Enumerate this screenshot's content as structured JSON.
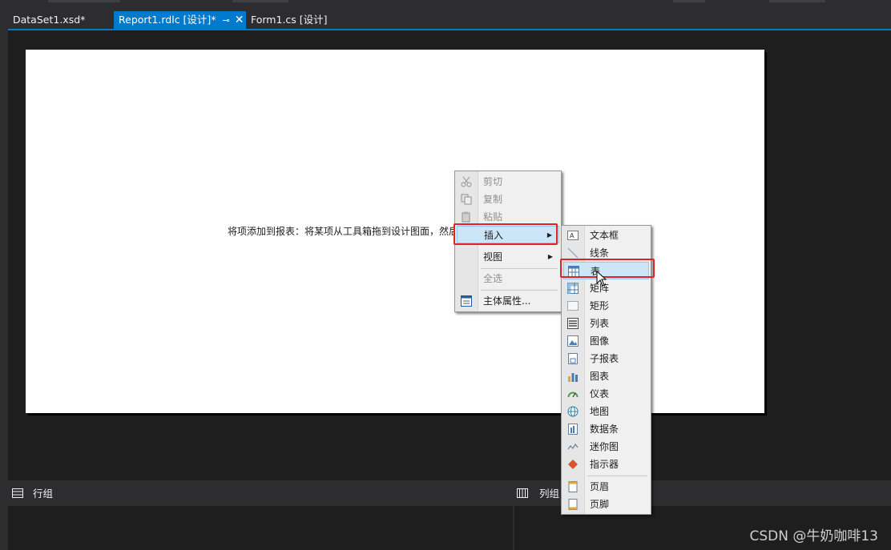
{
  "tabs": [
    {
      "label": "DataSet1.xsd*",
      "active": false
    },
    {
      "label": "Report1.rdlc [设计]*",
      "active": true,
      "pin": "⊸",
      "close": "✕"
    },
    {
      "label": "Form1.cs [设计]",
      "active": false
    }
  ],
  "design_surface": {
    "hint_text": "将项添加到报表：将某项从工具箱拖到设计图面，然后"
  },
  "groups": {
    "row_group_label": "行组",
    "column_group_label": "列组"
  },
  "context_menu": {
    "items": [
      {
        "label": "剪切",
        "icon": "scissors-icon",
        "disabled": true
      },
      {
        "label": "复制",
        "icon": "copy-icon",
        "disabled": true
      },
      {
        "label": "粘贴",
        "icon": "paste-icon",
        "disabled": true
      },
      {
        "label": "插入",
        "submenu": true,
        "highlighted": true
      },
      {
        "label": "视图",
        "submenu": true
      },
      {
        "label": "全选",
        "disabled": true
      },
      {
        "label": "主体属性...",
        "icon": "properties-icon"
      }
    ]
  },
  "insert_submenu": {
    "items": [
      {
        "label": "文本框",
        "icon": "textbox-icon"
      },
      {
        "label": "线条",
        "icon": "line-icon"
      },
      {
        "label": "表",
        "icon": "table-icon",
        "highlighted": true
      },
      {
        "label": "矩阵",
        "icon": "matrix-icon"
      },
      {
        "label": "矩形",
        "icon": "rectangle-icon"
      },
      {
        "label": "列表",
        "icon": "list-icon"
      },
      {
        "label": "图像",
        "icon": "image-icon"
      },
      {
        "label": "子报表",
        "icon": "subreport-icon"
      },
      {
        "label": "图表",
        "icon": "chart-icon"
      },
      {
        "label": "仪表",
        "icon": "gauge-icon"
      },
      {
        "label": "地图",
        "icon": "map-icon"
      },
      {
        "label": "数据条",
        "icon": "databar-icon"
      },
      {
        "label": "迷你图",
        "icon": "sparkline-icon"
      },
      {
        "label": "指示器",
        "icon": "indicator-icon"
      },
      {
        "label": "页眉",
        "icon": "page-header-icon"
      },
      {
        "label": "页脚",
        "icon": "page-footer-icon"
      }
    ]
  },
  "watermark": "CSDN @牛奶咖啡13",
  "colors": {
    "accent": "#007acc",
    "highlight_box": "#e02424",
    "surface": "#1e1e1e"
  }
}
